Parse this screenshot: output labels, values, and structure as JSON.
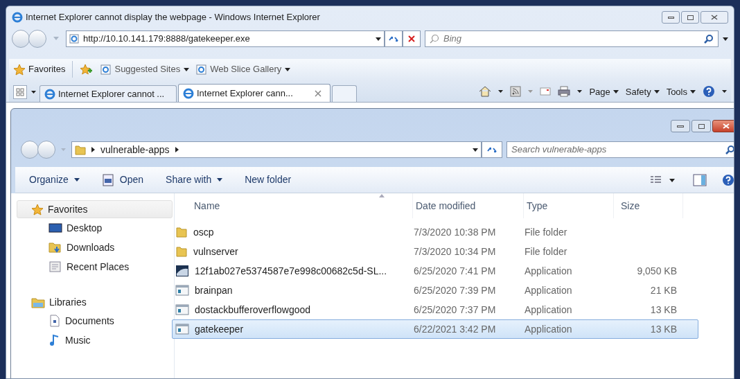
{
  "browser": {
    "title": "Internet Explorer cannot display the webpage - Windows Internet Explorer",
    "address": "http://10.10.141.179:8888/gatekeeper.exe",
    "search": {
      "placeholder": "Bing"
    },
    "favorites_bar": [
      {
        "label": "Favorites",
        "kind": "favorites"
      },
      {
        "label": "Suggested Sites",
        "kind": "link"
      },
      {
        "label": "Web Slice Gallery",
        "kind": "link"
      }
    ],
    "tabs": [
      {
        "label": "Internet Explorer cannot ...",
        "selected": false
      },
      {
        "label": "Internet Explorer cann...",
        "selected": true
      }
    ],
    "command_bar": [
      "Page",
      "Safety",
      "Tools"
    ]
  },
  "explorer": {
    "breadcrumb": [
      "vulnerable-apps"
    ],
    "search": {
      "placeholder": "Search vulnerable-apps"
    },
    "toolbar": [
      {
        "label": "Organize",
        "kind": "menu"
      },
      {
        "label": "Open",
        "kind": "open"
      },
      {
        "label": "Share with",
        "kind": "menu"
      },
      {
        "label": "New folder",
        "kind": "plain"
      }
    ],
    "nav": [
      {
        "label": "Favorites",
        "selected": true,
        "children": [
          {
            "label": "Desktop",
            "kind": "desktop"
          },
          {
            "label": "Downloads",
            "kind": "downloads"
          },
          {
            "label": "Recent Places",
            "kind": "recent"
          }
        ]
      },
      {
        "label": "Libraries",
        "selected": false,
        "children": [
          {
            "label": "Documents",
            "kind": "documents"
          },
          {
            "label": "Music",
            "kind": "music"
          }
        ]
      }
    ],
    "columns": [
      "Name",
      "Date modified",
      "Type",
      "Size"
    ],
    "rows": [
      {
        "name": "oscp",
        "date": "7/3/2020 10:38 PM",
        "type": "File folder",
        "kind": "folder",
        "selected": false
      },
      {
        "name": "vulnserver",
        "date": "7/3/2020 10:34 PM",
        "type": "File folder",
        "kind": "folder",
        "selected": false
      },
      {
        "name": "12f1ab027e5374587e7e998c00682c5d-SL...",
        "date": "6/25/2020 7:41 PM",
        "type": "Application",
        "size": "9,050 KB",
        "kind": "installer",
        "selected": false
      },
      {
        "name": "brainpan",
        "date": "6/25/2020 7:39 PM",
        "type": "Application",
        "size": "21 KB",
        "kind": "app",
        "selected": false
      },
      {
        "name": "dostackbufferoverflowgood",
        "date": "6/25/2020 7:37 PM",
        "type": "Application",
        "size": "13 KB",
        "kind": "app",
        "selected": false
      },
      {
        "name": "gatekeeper",
        "date": "6/22/2021 3:42 PM",
        "type": "Application",
        "size": "13 KB",
        "kind": "app",
        "selected": true
      }
    ]
  }
}
